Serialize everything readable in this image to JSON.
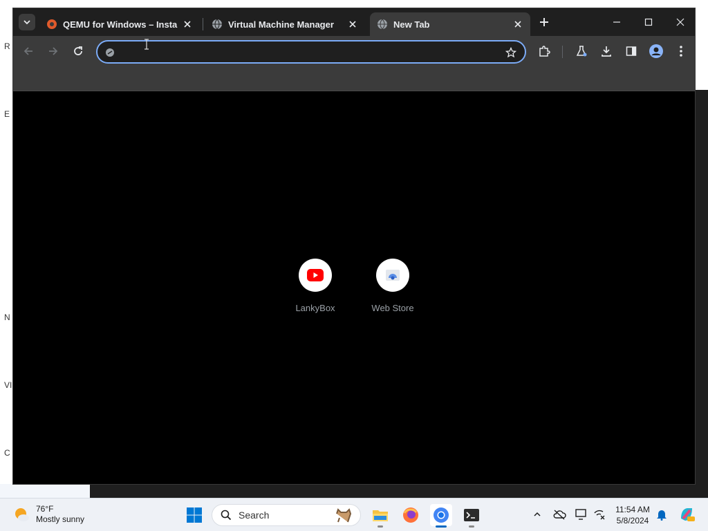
{
  "tabs": [
    {
      "title": "QEMU for Windows – Installers"
    },
    {
      "title": "Virtual Machine Manager"
    },
    {
      "title": "New Tab"
    }
  ],
  "omnibox": {
    "value": "",
    "placeholder": ""
  },
  "shortcuts": [
    {
      "label": "LankyBox"
    },
    {
      "label": "Web Store"
    }
  ],
  "desktop_fragments": [
    "R",
    "E",
    "N",
    "VI",
    "C"
  ],
  "taskbar": {
    "weather_temp": "76°F",
    "weather_desc": "Mostly sunny",
    "search_label": "Search",
    "time": "11:54 AM",
    "date": "5/8/2024"
  },
  "colors": {
    "accent": "#7cacf8",
    "toolbar": "#3b3b3b",
    "tabstrip": "#1f1f1f",
    "youtube_red": "#ff0000",
    "windows_blue": "#0067c0"
  }
}
